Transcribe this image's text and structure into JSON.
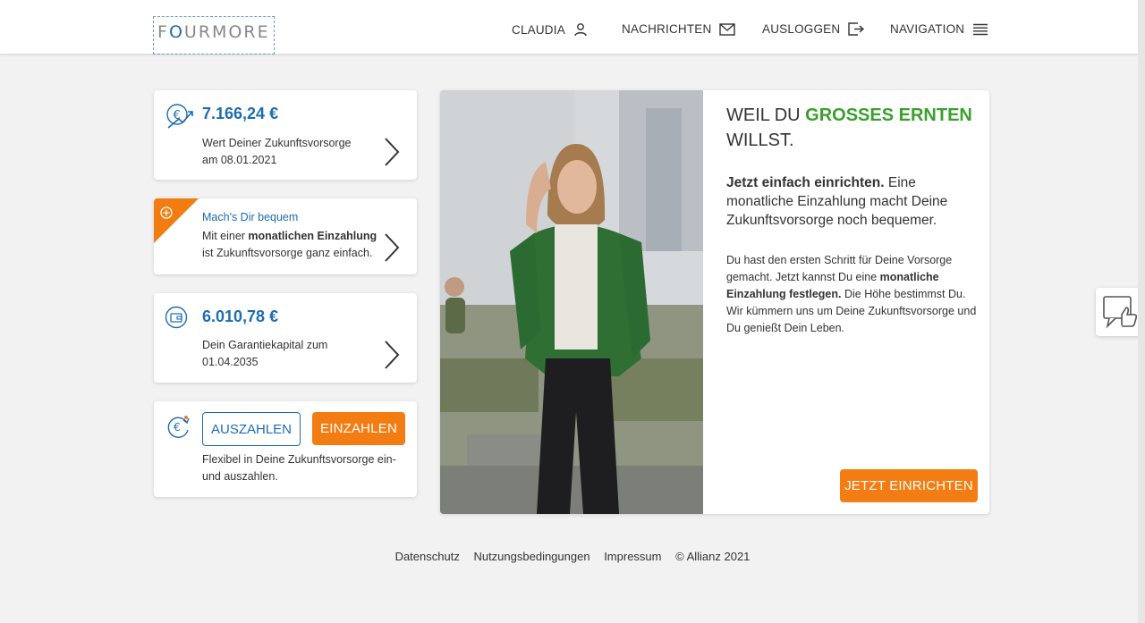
{
  "header": {
    "logo": {
      "pre": "F",
      "o": "O",
      "post": "URMORE"
    },
    "nav": {
      "user": "CLAUDIA",
      "messages": "NACHRICHTEN",
      "logout": "AUSLOGGEN",
      "navigation": "NAVIGATION"
    }
  },
  "cards": {
    "value": {
      "amount": "7.166,24 €",
      "line1": "Wert Deiner Zukunftsvorsorge",
      "line2": "am 08.01.2021"
    },
    "promo": {
      "title": "Mach's Dir bequem",
      "line1_pre": "Mit einer ",
      "line1_bold": "monatlichen Einzahlung",
      "line2": "ist Zukunftsvorsorge ganz einfach."
    },
    "guarantee": {
      "amount": "6.010,78 €",
      "line1": "Dein Garantiekapital zum",
      "line2": "01.04.2035"
    },
    "actions": {
      "payout": "AUSZAHLEN",
      "payin": "EINZAHLEN",
      "line1": "Flexibel in Deine Zukunftsvorsorge ein-",
      "line2": "und auszahlen."
    }
  },
  "hero": {
    "head_pre": "WEIL DU ",
    "head_highlight": "GROSSES ERNTEN",
    "head_line2": "WILLST.",
    "lead_bold": "Jetzt einfach einrichten.",
    "lead_rest": " Eine monatliche Einzahlung macht Deine Zukunftsvorsorge noch bequemer.",
    "body_pre": "Du hast den ersten Schritt für Deine Vorsorge gemacht. Jetzt kannst Du eine ",
    "body_bold": "monatliche Einzahlung festlegen.",
    "body_post": " Die Höhe bestimmst Du. Wir kümmern uns um Deine Zukunftsvorsorge und Du genießt Dein Leben.",
    "cta": "JETZT EINRICHTEN"
  },
  "footer": {
    "privacy": "Datenschutz",
    "terms": "Nutzungsbedingungen",
    "imprint": "Impressum",
    "copyright": "© Allianz 2021"
  },
  "colors": {
    "brand_blue": "#1c6db0",
    "accent_orange": "#f47d13",
    "highlight_green": "#3aa02c"
  },
  "icons": [
    "user-icon",
    "mail-icon",
    "logout-icon",
    "menu-icon",
    "euro-growth-icon",
    "chevron-right-icon",
    "plus-icon",
    "wallet-icon",
    "euro-cycle-icon",
    "feedback-icon"
  ]
}
